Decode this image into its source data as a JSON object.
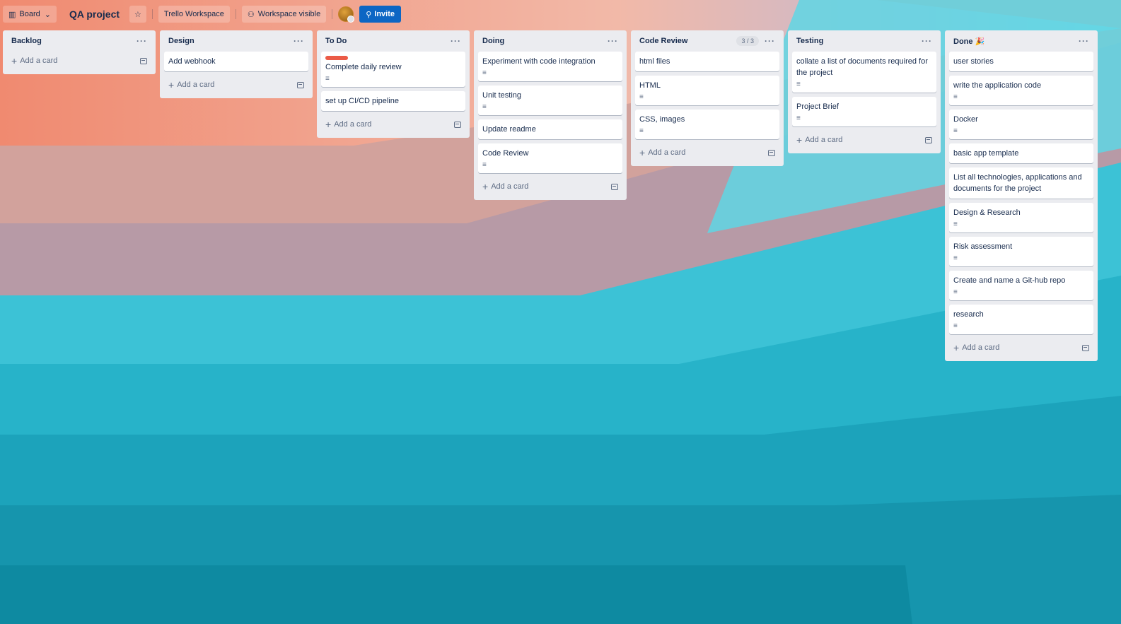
{
  "topbar": {
    "view_label": "Board",
    "board_title": "QA project",
    "workspace_label": "Trello Workspace",
    "visibility_label": "Workspace visible",
    "invite_label": "Invite"
  },
  "add_card_label": "Add a card",
  "lists": [
    {
      "title": "Backlog",
      "cards": []
    },
    {
      "title": "Design",
      "cards": [
        {
          "title": "Add webhook"
        }
      ]
    },
    {
      "title": "To Do",
      "cards": [
        {
          "title": "Complete daily review",
          "label_color": "#eb5a46",
          "has_description": true
        },
        {
          "title": "set up CI/CD pipeline"
        }
      ]
    },
    {
      "title": "Doing",
      "cards": [
        {
          "title": "Experiment with code integration",
          "has_description": true
        },
        {
          "title": "Unit testing",
          "has_description": true
        },
        {
          "title": "Update readme"
        },
        {
          "title": "Code Review",
          "has_description": true
        }
      ]
    },
    {
      "title": "Code Review",
      "count": "3 / 3",
      "cards": [
        {
          "title": "html files"
        },
        {
          "title": "HTML",
          "has_description": true
        },
        {
          "title": "CSS, images",
          "has_description": true
        }
      ]
    },
    {
      "title": "Testing",
      "cards": [
        {
          "title": "collate a list of documents required for the project",
          "has_description": true
        },
        {
          "title": "Project Brief",
          "has_description": true
        }
      ]
    },
    {
      "title": "Done 🎉",
      "cards": [
        {
          "title": "user stories"
        },
        {
          "title": "write the application code",
          "has_description": true
        },
        {
          "title": "Docker",
          "has_description": true
        },
        {
          "title": "basic app template"
        },
        {
          "title": "List all technologies, applications and documents for the project"
        },
        {
          "title": "Design & Research",
          "has_description": true
        },
        {
          "title": "Risk assessment",
          "has_description": true
        },
        {
          "title": "Create and name a Git-hub repo",
          "has_description": true
        },
        {
          "title": "research",
          "has_description": true
        }
      ]
    }
  ]
}
